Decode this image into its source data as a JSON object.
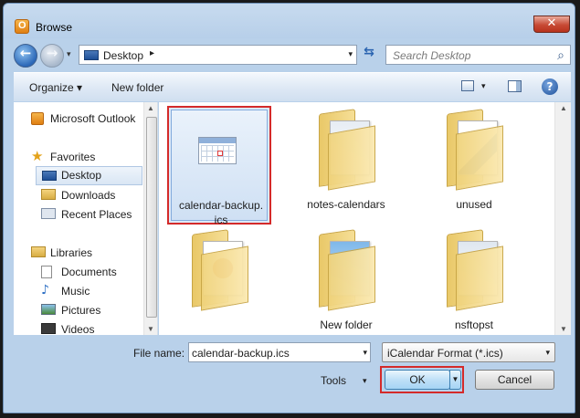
{
  "window": {
    "title": "Browse",
    "close_glyph": "✕"
  },
  "address": {
    "location": "Desktop",
    "separator": "▸",
    "dropdown": "▾",
    "refresh_glyph": "⇆"
  },
  "nav": {
    "back_glyph": "←",
    "forward_glyph": "→",
    "recent_glyph": "▾"
  },
  "search": {
    "placeholder": "Search Desktop",
    "icon_glyph": "⌕"
  },
  "toolbar": {
    "organize_label": "Organize ▾",
    "new_folder_label": "New folder",
    "views_drop": "▾",
    "help_glyph": "?"
  },
  "navpane": {
    "items": [
      {
        "label": "Microsoft Outlook",
        "icon": "outlook-icon"
      },
      {
        "label": "Favorites",
        "icon": "star-icon"
      },
      {
        "label": "Desktop",
        "icon": "desktop-icon",
        "selected": true
      },
      {
        "label": "Downloads",
        "icon": "downloads-icon"
      },
      {
        "label": "Recent Places",
        "icon": "recent-places-icon"
      },
      {
        "label": "Libraries",
        "icon": "libraries-icon"
      },
      {
        "label": "Documents",
        "icon": "documents-icon"
      },
      {
        "label": "Music",
        "icon": "music-icon"
      },
      {
        "label": "Pictures",
        "icon": "pictures-icon"
      },
      {
        "label": "Videos",
        "icon": "videos-icon"
      }
    ]
  },
  "files": [
    {
      "label": "calendar-backup.\nics",
      "type": "ics",
      "selected": true
    },
    {
      "label": "notes-calendars",
      "type": "folder"
    },
    {
      "label": "unused",
      "type": "folder"
    },
    {
      "label": "",
      "type": "folder"
    },
    {
      "label": "New folder",
      "type": "folder"
    },
    {
      "label": "nsftopst",
      "type": "folder"
    }
  ],
  "bottom": {
    "file_name_label": "File name:",
    "file_name_value": "calendar-backup.ics",
    "filter_value": "iCalendar Format (*.ics)",
    "tools_label": "Tools",
    "ok_label": "OK",
    "cancel_label": "Cancel"
  },
  "colors": {
    "highlight_red": "#d42a2a",
    "selection_blue": "#dce9f8",
    "chrome_blue": "#b9d1ea"
  }
}
